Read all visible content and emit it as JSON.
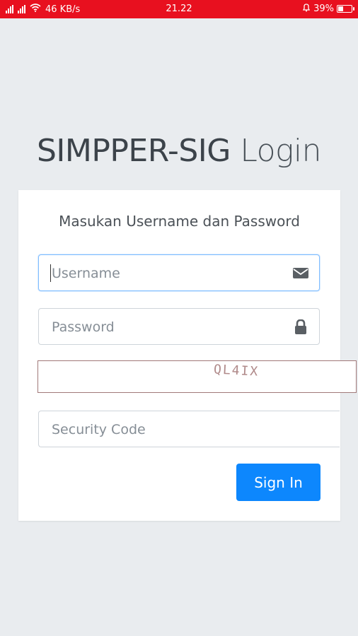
{
  "status_bar": {
    "network_speed": "46 KB/s",
    "time": "21.22",
    "battery_percent": "39%",
    "background_color": "#e8101f",
    "icons": [
      "signal-icon",
      "signal-icon",
      "wifi-icon",
      "alarm-icon",
      "battery-icon"
    ]
  },
  "page": {
    "title_main": "SIMPPER-SIG",
    "title_sub": "Login"
  },
  "card": {
    "message": "Masukan Username dan Password",
    "username_placeholder": "Username",
    "password_placeholder": "Password",
    "captcha_text": "QL4IX",
    "security_code_placeholder": "Security Code",
    "signin_label": "Sign In",
    "button_color": "#0d87fd"
  }
}
